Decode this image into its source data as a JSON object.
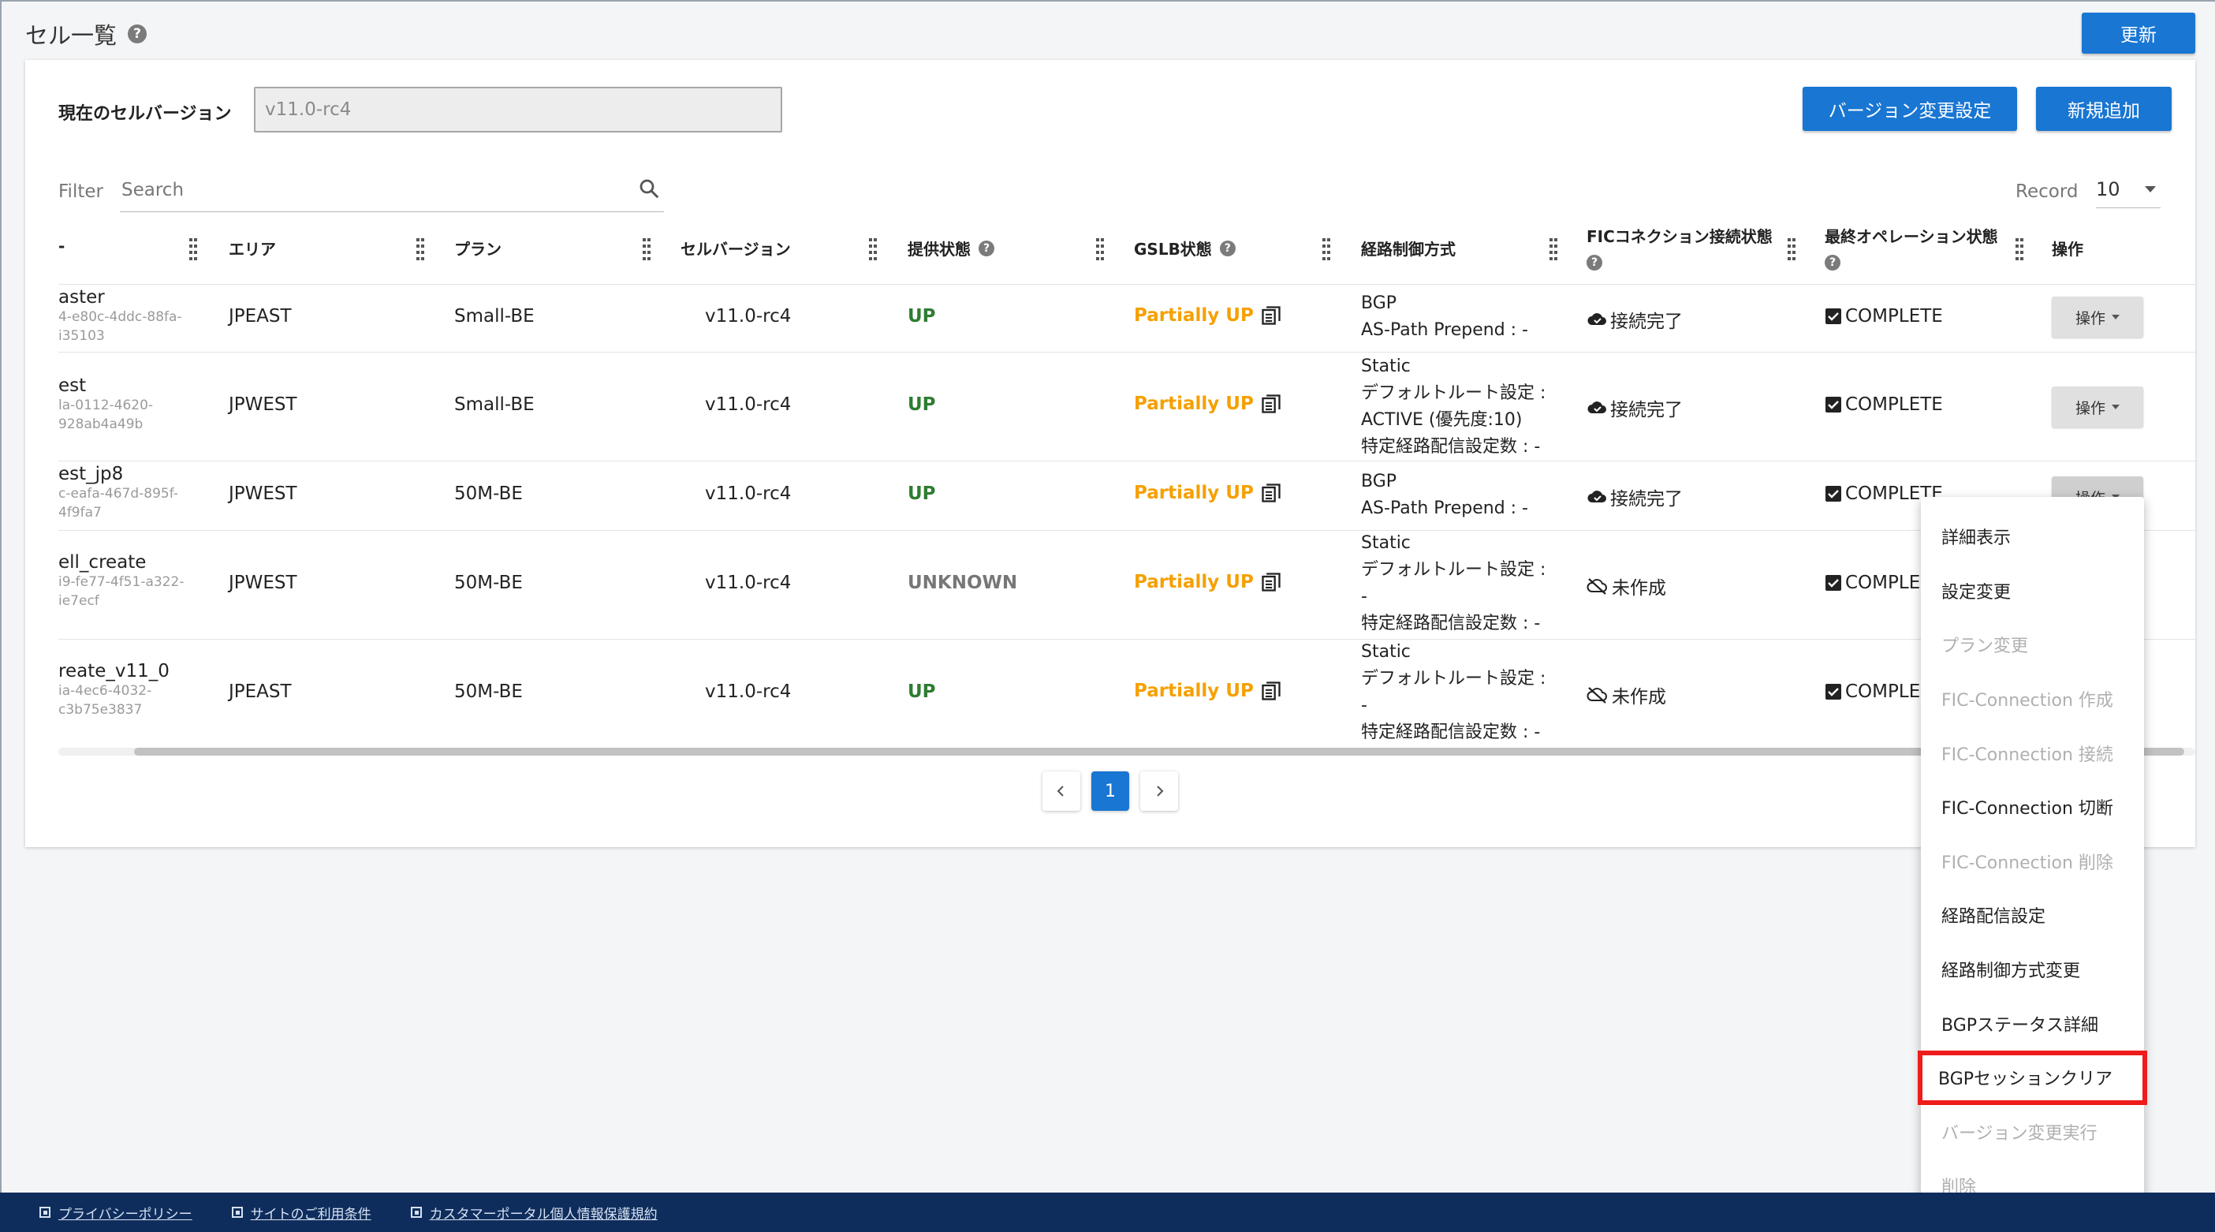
{
  "header": {
    "title": "セル一覧",
    "refresh_label": "更新"
  },
  "toolbar": {
    "version_label": "現在のセルバージョン",
    "version_value": "v11.0-rc4",
    "version_change_label": "バージョン変更設定",
    "add_label": "新規追加",
    "filter_label": "Filter",
    "search_placeholder": "Search",
    "record_label": "Record",
    "record_value": "10"
  },
  "table": {
    "columns": [
      "-",
      "エリア",
      "プラン",
      "セルバージョン",
      "提供状態",
      "GSLB状態",
      "経路制御方式",
      "FICコネクション接続状態",
      "最終オペレーション状態",
      "操作"
    ],
    "rows": [
      {
        "name": "aster",
        "id1": "4-e80c-4ddc-88fa-",
        "id2": "i35103",
        "area": "JPEAST",
        "plan": "Small-BE",
        "version": "v11.0-rc4",
        "status": "UP",
        "gslb": "Partially UP",
        "route": [
          "BGP",
          "AS-Path Prepend : -"
        ],
        "fic": "接続完了",
        "op_state": "COMPLETE",
        "op_label": "操作"
      },
      {
        "name": "est",
        "id1": "la-0112-4620-",
        "id2": "928ab4a49b",
        "area": "JPWEST",
        "plan": "Small-BE",
        "version": "v11.0-rc4",
        "status": "UP",
        "gslb": "Partially UP",
        "route": [
          "Static",
          "デフォルトルート設定 :",
          "ACTIVE (優先度:10)",
          "特定経路配信設定数 : -"
        ],
        "fic": "接続完了",
        "op_state": "COMPLETE",
        "op_label": "操作"
      },
      {
        "name": "est_jp8",
        "id1": "c-eafa-467d-895f-",
        "id2": "4f9fa7",
        "area": "JPWEST",
        "plan": "50M-BE",
        "version": "v11.0-rc4",
        "status": "UP",
        "gslb": "Partially UP",
        "route": [
          "BGP",
          "AS-Path Prepend : -"
        ],
        "fic": "接続完了",
        "op_state": "COMPLETE",
        "op_label": "操作"
      },
      {
        "name": "ell_create",
        "id1": "i9-fe77-4f51-a322-",
        "id2": "ie7ecf",
        "area": "JPWEST",
        "plan": "50M-BE",
        "version": "v11.0-rc4",
        "status": "UNKNOWN",
        "gslb": "Partially UP",
        "route": [
          "Static",
          "デフォルトルート設定 :",
          "-",
          "特定経路配信設定数 : -"
        ],
        "fic": "未作成",
        "op_state": "COMPLE",
        "op_label": ""
      },
      {
        "name": "reate_v11_0",
        "id1": "ia-4ec6-4032-",
        "id2": "c3b75e3837",
        "area": "JPEAST",
        "plan": "50M-BE",
        "version": "v11.0-rc4",
        "status": "UP",
        "gslb": "Partially UP",
        "route": [
          "Static",
          "デフォルトルート設定 :",
          "-",
          "特定経路配信設定数 : -"
        ],
        "fic": "未作成",
        "op_state": "COMPLE",
        "op_label": ""
      }
    ]
  },
  "pagination": {
    "current": "1"
  },
  "menu": {
    "items": [
      {
        "label": "詳細表示",
        "disabled": false,
        "highlighted": false
      },
      {
        "label": "設定変更",
        "disabled": false,
        "highlighted": false
      },
      {
        "label": "プラン変更",
        "disabled": true,
        "highlighted": false
      },
      {
        "label": "FIC-Connection 作成",
        "disabled": true,
        "highlighted": false
      },
      {
        "label": "FIC-Connection 接続",
        "disabled": true,
        "highlighted": false
      },
      {
        "label": "FIC-Connection 切断",
        "disabled": false,
        "highlighted": false
      },
      {
        "label": "FIC-Connection 削除",
        "disabled": true,
        "highlighted": false
      },
      {
        "label": "経路配信設定",
        "disabled": false,
        "highlighted": false
      },
      {
        "label": "経路制御方式変更",
        "disabled": false,
        "highlighted": false
      },
      {
        "label": "BGPステータス詳細",
        "disabled": false,
        "highlighted": false
      },
      {
        "label": "BGPセッションクリア",
        "disabled": false,
        "highlighted": true
      },
      {
        "label": "バージョン変更実行",
        "disabled": true,
        "highlighted": false
      },
      {
        "label": "削除",
        "disabled": true,
        "highlighted": false
      }
    ]
  },
  "footer": {
    "links": [
      "プライバシーポリシー",
      "サイトのご利用条件",
      "カスタマーポータル個人情報保護規約"
    ]
  },
  "colors": {
    "primary": "#1976d2",
    "up": "#2e7d32",
    "partial": "#f5a000",
    "footer": "#0f2d5c",
    "highlight": "#ee1c1c"
  }
}
